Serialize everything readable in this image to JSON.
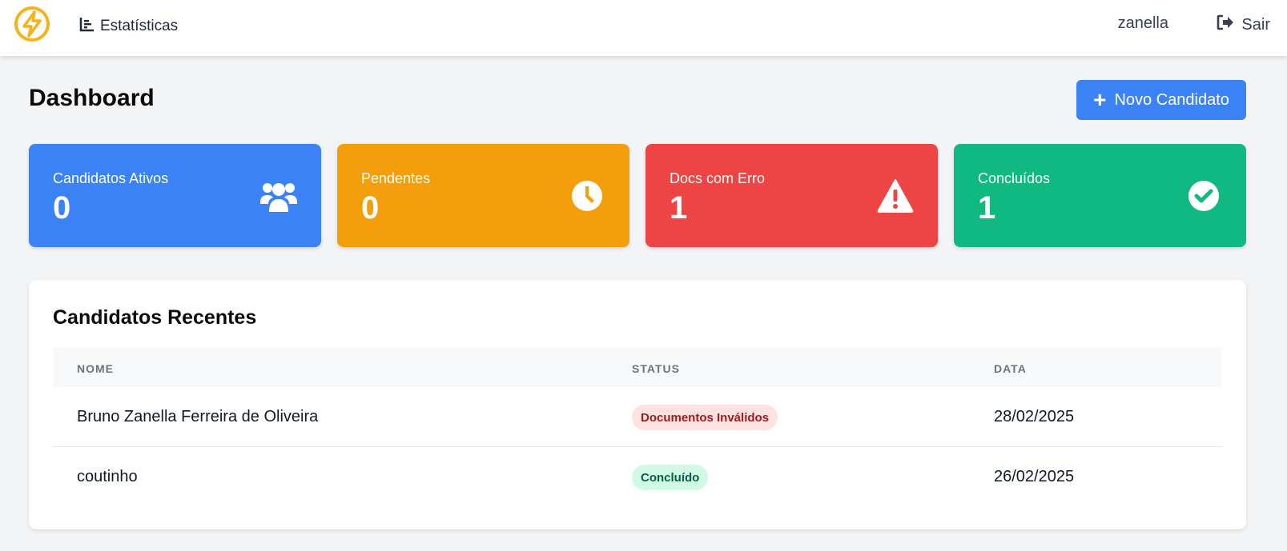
{
  "header": {
    "nav_stats_label": "Estatísticas",
    "user_name": "zanella",
    "logout_label": "Sair",
    "logo_icon": "lightning-bolt-icon"
  },
  "page": {
    "title": "Dashboard",
    "new_button_label": "Novo Candidato"
  },
  "stats": [
    {
      "label": "Candidatos Ativos",
      "value": "0",
      "icon": "users-icon",
      "color": "#3b82f6"
    },
    {
      "label": "Pendentes",
      "value": "0",
      "icon": "clock-icon",
      "color": "#f59e0b"
    },
    {
      "label": "Docs com Erro",
      "value": "1",
      "icon": "warning-icon",
      "color": "#ef4444"
    },
    {
      "label": "Concluídos",
      "value": "1",
      "icon": "check-circle-icon",
      "color": "#10b981"
    }
  ],
  "recent": {
    "title": "Candidatos Recentes",
    "columns": [
      "NOME",
      "STATUS",
      "DATA"
    ],
    "rows": [
      {
        "name": "Bruno Zanella Ferreira de Oliveira",
        "status": "Documentos Inválidos",
        "status_type": "error",
        "date": "28/02/2025"
      },
      {
        "name": "coutinho",
        "status": "Concluído",
        "status_type": "success",
        "date": "26/02/2025"
      }
    ]
  }
}
